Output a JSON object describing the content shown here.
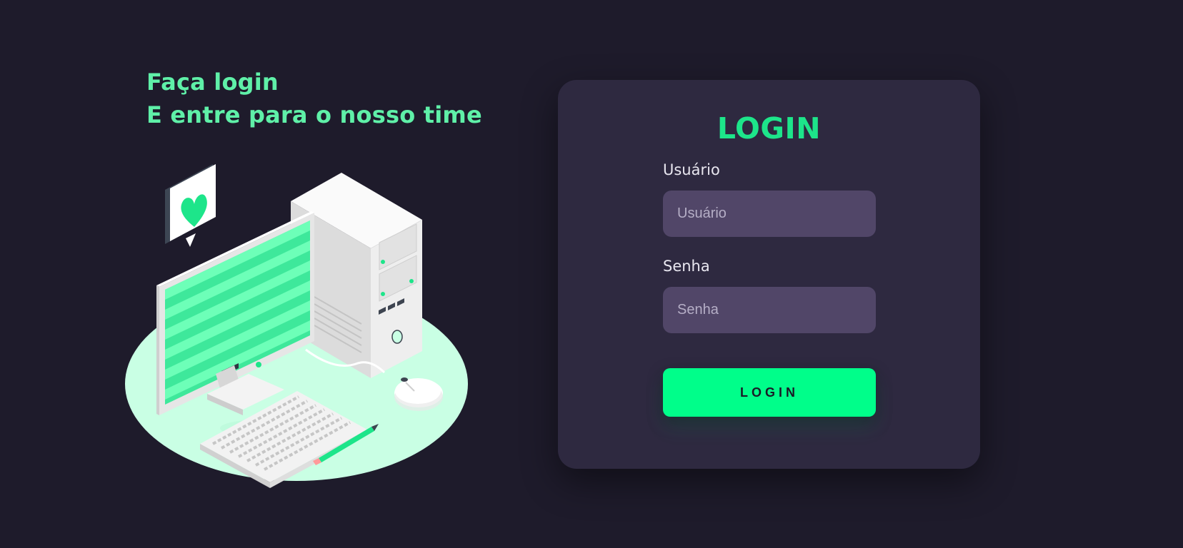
{
  "hero": {
    "line1": "Faça login",
    "line2": "E entre para o nosso time"
  },
  "illustration": {
    "icon": "computer-desk-illustration",
    "badge_icon": "heart-icon"
  },
  "login_card": {
    "title": "LOGIN",
    "username_label": "Usuário",
    "username_placeholder": "Usuário",
    "username_value": "",
    "password_label": "Senha",
    "password_placeholder": "Senha",
    "password_value": "",
    "submit_label": "LOGIN"
  },
  "colors": {
    "background": "#1e1b2b",
    "card": "#2e2940",
    "accent": "#00fe8a",
    "heading": "#5ff0a8",
    "input": "#514668"
  }
}
